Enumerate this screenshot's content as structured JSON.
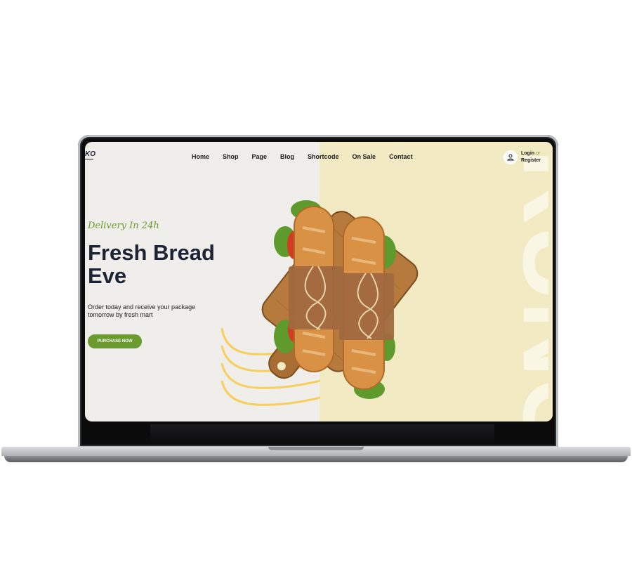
{
  "brand": {
    "logo_text": "KO"
  },
  "nav": {
    "items": [
      "Home",
      "Shop",
      "Page",
      "Blog",
      "Shortcode",
      "On Sale",
      "Contact"
    ]
  },
  "auth": {
    "login": "Login",
    "or": "or",
    "register": "Register"
  },
  "hero": {
    "tagline": "Delivery In 24h",
    "headline": "Fresh Bread Eve",
    "subtext": "Order today and receive your package tomorrow by fresh mart",
    "cta_label": "PURCHASE NOW",
    "background_word": "RUNC"
  },
  "colors": {
    "accent": "#6b9a2f",
    "panel": "#f1eac2",
    "headline": "#1c2335",
    "wave": "#f7cf5a"
  },
  "icons": {
    "user": "user-icon"
  }
}
